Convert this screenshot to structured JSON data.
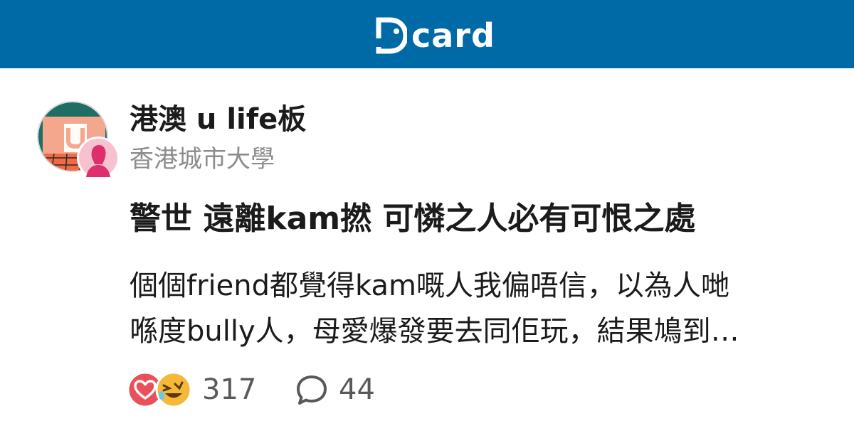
{
  "header": {
    "logo_text": "card",
    "brand_color": "#006aa6"
  },
  "forum": {
    "name": "港澳 u life板",
    "school": "香港城市大學",
    "avatar_icon": "forum-u-life-icon",
    "school_avatar_icon": "female-user-icon"
  },
  "post": {
    "title": "警世 遠離kam撚 可憐之人必有可恨之處",
    "excerpt_lines": [
      "個個friend都覺得kam嘅人我偏唔信，以為人哋",
      "喺度bully人，母愛爆發要去同佢玩，結果鳩到…"
    ]
  },
  "stats": {
    "reaction_icons": [
      "heart-icon",
      "laughing-face-icon"
    ],
    "likes": "317",
    "comment_icon": "comment-bubble-icon",
    "comments": "44"
  },
  "colors": {
    "text_primary": "#1b1b1b",
    "text_secondary": "#8c8c8c",
    "stat_text": "#595959",
    "heart": "#e9505a",
    "laugh": "#f5b939"
  }
}
